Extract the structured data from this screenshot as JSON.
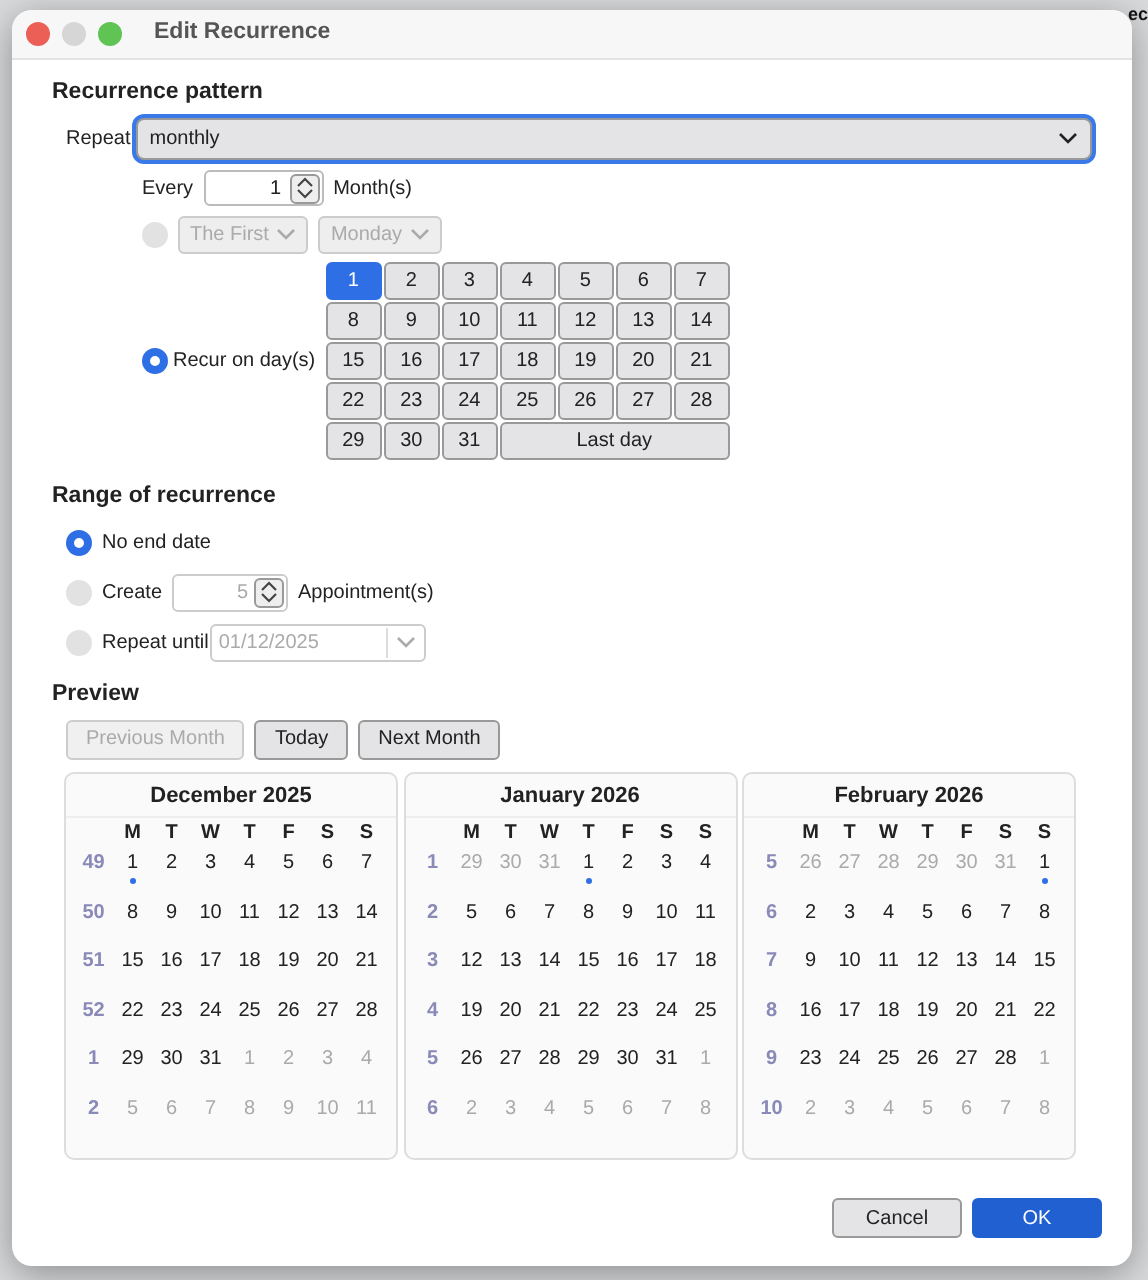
{
  "background_text": "ec",
  "window": {
    "title": "Edit Recurrence"
  },
  "pattern": {
    "heading": "Recurrence pattern",
    "repeat_label": "Repeat",
    "repeat_value": "monthly",
    "every_label": "Every",
    "every_value": "1",
    "every_unit": "Month(s)",
    "ordinal_option": {
      "selected": false,
      "disabled": true,
      "ordinal": "The First",
      "weekday": "Monday"
    },
    "days_option": {
      "selected": true,
      "label": "Recur on day(s)"
    },
    "days": [
      {
        "label": "1",
        "selected": true
      },
      {
        "label": "2",
        "selected": false
      },
      {
        "label": "3",
        "selected": false
      },
      {
        "label": "4",
        "selected": false
      },
      {
        "label": "5",
        "selected": false
      },
      {
        "label": "6",
        "selected": false
      },
      {
        "label": "7",
        "selected": false
      },
      {
        "label": "8",
        "selected": false
      },
      {
        "label": "9",
        "selected": false
      },
      {
        "label": "10",
        "selected": false
      },
      {
        "label": "11",
        "selected": false
      },
      {
        "label": "12",
        "selected": false
      },
      {
        "label": "13",
        "selected": false
      },
      {
        "label": "14",
        "selected": false
      },
      {
        "label": "15",
        "selected": false
      },
      {
        "label": "16",
        "selected": false
      },
      {
        "label": "17",
        "selected": false
      },
      {
        "label": "18",
        "selected": false
      },
      {
        "label": "19",
        "selected": false
      },
      {
        "label": "20",
        "selected": false
      },
      {
        "label": "21",
        "selected": false
      },
      {
        "label": "22",
        "selected": false
      },
      {
        "label": "23",
        "selected": false
      },
      {
        "label": "24",
        "selected": false
      },
      {
        "label": "25",
        "selected": false
      },
      {
        "label": "26",
        "selected": false
      },
      {
        "label": "27",
        "selected": false
      },
      {
        "label": "28",
        "selected": false
      },
      {
        "label": "29",
        "selected": false
      },
      {
        "label": "30",
        "selected": false
      },
      {
        "label": "31",
        "selected": false
      },
      {
        "label": "Last day",
        "selected": false,
        "kind": "wide"
      }
    ]
  },
  "range": {
    "heading": "Range of recurrence",
    "options": [
      {
        "kind": "plain",
        "label": "No end date",
        "selected": true
      },
      {
        "kind": "count",
        "label": "Create",
        "value": "5",
        "unit": "Appointment(s)",
        "selected": false
      },
      {
        "kind": "date",
        "label": "Repeat until",
        "value": "01/12/2025",
        "selected": false
      }
    ]
  },
  "preview": {
    "heading": "Preview",
    "buttons": [
      {
        "label": "Previous Month",
        "disabled": true
      },
      {
        "label": "Today",
        "disabled": false
      },
      {
        "label": "Next Month",
        "disabled": false
      }
    ],
    "months": [
      {
        "title": "December 2025",
        "weekdays": [
          "M",
          "T",
          "W",
          "T",
          "F",
          "S",
          "S"
        ],
        "weeks": [
          {
            "week": "49",
            "days": [
              {
                "d": "1",
                "muted": false,
                "dot": true
              },
              {
                "d": "2",
                "muted": false
              },
              {
                "d": "3",
                "muted": false
              },
              {
                "d": "4",
                "muted": false
              },
              {
                "d": "5",
                "muted": false
              },
              {
                "d": "6",
                "muted": false
              },
              {
                "d": "7",
                "muted": false
              }
            ]
          },
          {
            "week": "50",
            "days": [
              {
                "d": "8",
                "muted": false
              },
              {
                "d": "9",
                "muted": false
              },
              {
                "d": "10",
                "muted": false
              },
              {
                "d": "11",
                "muted": false
              },
              {
                "d": "12",
                "muted": false
              },
              {
                "d": "13",
                "muted": false
              },
              {
                "d": "14",
                "muted": false
              }
            ]
          },
          {
            "week": "51",
            "days": [
              {
                "d": "15",
                "muted": false
              },
              {
                "d": "16",
                "muted": false
              },
              {
                "d": "17",
                "muted": false
              },
              {
                "d": "18",
                "muted": false
              },
              {
                "d": "19",
                "muted": false
              },
              {
                "d": "20",
                "muted": false
              },
              {
                "d": "21",
                "muted": false
              }
            ]
          },
          {
            "week": "52",
            "days": [
              {
                "d": "22",
                "muted": false
              },
              {
                "d": "23",
                "muted": false
              },
              {
                "d": "24",
                "muted": false
              },
              {
                "d": "25",
                "muted": false
              },
              {
                "d": "26",
                "muted": false
              },
              {
                "d": "27",
                "muted": false
              },
              {
                "d": "28",
                "muted": false
              }
            ]
          },
          {
            "week": "1",
            "days": [
              {
                "d": "29",
                "muted": false
              },
              {
                "d": "30",
                "muted": false
              },
              {
                "d": "31",
                "muted": false
              },
              {
                "d": "1",
                "muted": true
              },
              {
                "d": "2",
                "muted": true
              },
              {
                "d": "3",
                "muted": true
              },
              {
                "d": "4",
                "muted": true
              }
            ]
          },
          {
            "week": "2",
            "days": [
              {
                "d": "5",
                "muted": true
              },
              {
                "d": "6",
                "muted": true
              },
              {
                "d": "7",
                "muted": true
              },
              {
                "d": "8",
                "muted": true
              },
              {
                "d": "9",
                "muted": true
              },
              {
                "d": "10",
                "muted": true
              },
              {
                "d": "11",
                "muted": true
              }
            ]
          }
        ]
      },
      {
        "title": "January 2026",
        "weekdays": [
          "M",
          "T",
          "W",
          "T",
          "F",
          "S",
          "S"
        ],
        "weeks": [
          {
            "week": "1",
            "days": [
              {
                "d": "29",
                "muted": true
              },
              {
                "d": "30",
                "muted": true
              },
              {
                "d": "31",
                "muted": true
              },
              {
                "d": "1",
                "muted": false,
                "dot": true
              },
              {
                "d": "2",
                "muted": false
              },
              {
                "d": "3",
                "muted": false
              },
              {
                "d": "4",
                "muted": false
              }
            ]
          },
          {
            "week": "2",
            "days": [
              {
                "d": "5",
                "muted": false
              },
              {
                "d": "6",
                "muted": false
              },
              {
                "d": "7",
                "muted": false
              },
              {
                "d": "8",
                "muted": false
              },
              {
                "d": "9",
                "muted": false
              },
              {
                "d": "10",
                "muted": false
              },
              {
                "d": "11",
                "muted": false
              }
            ]
          },
          {
            "week": "3",
            "days": [
              {
                "d": "12",
                "muted": false
              },
              {
                "d": "13",
                "muted": false
              },
              {
                "d": "14",
                "muted": false
              },
              {
                "d": "15",
                "muted": false
              },
              {
                "d": "16",
                "muted": false
              },
              {
                "d": "17",
                "muted": false
              },
              {
                "d": "18",
                "muted": false
              }
            ]
          },
          {
            "week": "4",
            "days": [
              {
                "d": "19",
                "muted": false
              },
              {
                "d": "20",
                "muted": false
              },
              {
                "d": "21",
                "muted": false
              },
              {
                "d": "22",
                "muted": false
              },
              {
                "d": "23",
                "muted": false
              },
              {
                "d": "24",
                "muted": false
              },
              {
                "d": "25",
                "muted": false
              }
            ]
          },
          {
            "week": "5",
            "days": [
              {
                "d": "26",
                "muted": false
              },
              {
                "d": "27",
                "muted": false
              },
              {
                "d": "28",
                "muted": false
              },
              {
                "d": "29",
                "muted": false
              },
              {
                "d": "30",
                "muted": false
              },
              {
                "d": "31",
                "muted": false
              },
              {
                "d": "1",
                "muted": true
              }
            ]
          },
          {
            "week": "6",
            "days": [
              {
                "d": "2",
                "muted": true
              },
              {
                "d": "3",
                "muted": true
              },
              {
                "d": "4",
                "muted": true
              },
              {
                "d": "5",
                "muted": true
              },
              {
                "d": "6",
                "muted": true
              },
              {
                "d": "7",
                "muted": true
              },
              {
                "d": "8",
                "muted": true
              }
            ]
          }
        ]
      },
      {
        "title": "February 2026",
        "weekdays": [
          "M",
          "T",
          "W",
          "T",
          "F",
          "S",
          "S"
        ],
        "weeks": [
          {
            "week": "5",
            "days": [
              {
                "d": "26",
                "muted": true
              },
              {
                "d": "27",
                "muted": true
              },
              {
                "d": "28",
                "muted": true
              },
              {
                "d": "29",
                "muted": true
              },
              {
                "d": "30",
                "muted": true
              },
              {
                "d": "31",
                "muted": true
              },
              {
                "d": "1",
                "muted": false,
                "dot": true
              }
            ]
          },
          {
            "week": "6",
            "days": [
              {
                "d": "2",
                "muted": false
              },
              {
                "d": "3",
                "muted": false
              },
              {
                "d": "4",
                "muted": false
              },
              {
                "d": "5",
                "muted": false
              },
              {
                "d": "6",
                "muted": false
              },
              {
                "d": "7",
                "muted": false
              },
              {
                "d": "8",
                "muted": false
              }
            ]
          },
          {
            "week": "7",
            "days": [
              {
                "d": "9",
                "muted": false
              },
              {
                "d": "10",
                "muted": false
              },
              {
                "d": "11",
                "muted": false
              },
              {
                "d": "12",
                "muted": false
              },
              {
                "d": "13",
                "muted": false
              },
              {
                "d": "14",
                "muted": false
              },
              {
                "d": "15",
                "muted": false
              }
            ]
          },
          {
            "week": "8",
            "days": [
              {
                "d": "16",
                "muted": false
              },
              {
                "d": "17",
                "muted": false
              },
              {
                "d": "18",
                "muted": false
              },
              {
                "d": "19",
                "muted": false
              },
              {
                "d": "20",
                "muted": false
              },
              {
                "d": "21",
                "muted": false
              },
              {
                "d": "22",
                "muted": false
              }
            ]
          },
          {
            "week": "9",
            "days": [
              {
                "d": "23",
                "muted": false
              },
              {
                "d": "24",
                "muted": false
              },
              {
                "d": "25",
                "muted": false
              },
              {
                "d": "26",
                "muted": false
              },
              {
                "d": "27",
                "muted": false
              },
              {
                "d": "28",
                "muted": false
              },
              {
                "d": "1",
                "muted": true
              }
            ]
          },
          {
            "week": "10",
            "days": [
              {
                "d": "2",
                "muted": true
              },
              {
                "d": "3",
                "muted": true
              },
              {
                "d": "4",
                "muted": true
              },
              {
                "d": "5",
                "muted": true
              },
              {
                "d": "6",
                "muted": true
              },
              {
                "d": "7",
                "muted": true
              },
              {
                "d": "8",
                "muted": true
              }
            ]
          }
        ]
      }
    ]
  },
  "footer": {
    "buttons": [
      {
        "label": "Cancel",
        "kind": "secondary"
      },
      {
        "label": "OK",
        "kind": "primary"
      }
    ]
  }
}
